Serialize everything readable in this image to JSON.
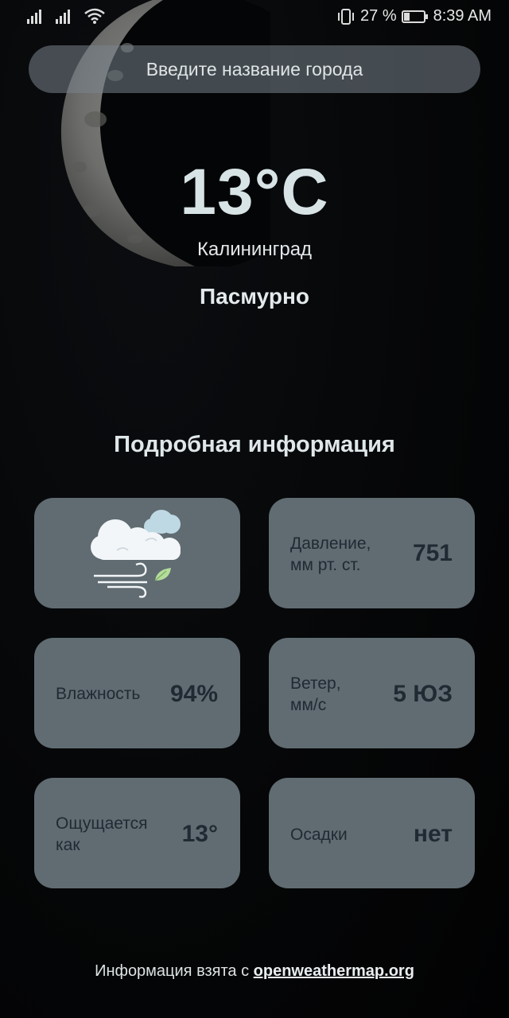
{
  "status_bar": {
    "battery_percent": "27 %",
    "time": "8:39 AM",
    "icons": [
      "signal-icon",
      "signal-icon",
      "wifi-icon",
      "vibrate-icon",
      "battery-icon"
    ]
  },
  "search": {
    "placeholder": "Введите название города",
    "value": ""
  },
  "weather": {
    "temperature": "13°C",
    "city": "Калининград",
    "condition": "Пасмурно",
    "icon": "cloudy-windy-icon"
  },
  "details": {
    "title": "Подробная информация",
    "pressure_label_line1": "Давление,",
    "pressure_label_line2": "мм рт. ст.",
    "pressure_value": "751",
    "humidity_label": "Влажность",
    "humidity_value": "94%",
    "wind_label_line1": "Ветер,",
    "wind_label_line2": "мм/с",
    "wind_value": "5 ЮЗ",
    "feels_label_line1": "Ощущается",
    "feels_label_line2": "как",
    "feels_value": "13°",
    "precip_label": "Осадки",
    "precip_value": "нет"
  },
  "footer": {
    "text": "Информация взята с",
    "link": "openweathermap.org"
  },
  "colors": {
    "background": "#000000",
    "card": "#606c72",
    "card_text": "#1f2a33",
    "main_text": "#dfe6e8"
  }
}
